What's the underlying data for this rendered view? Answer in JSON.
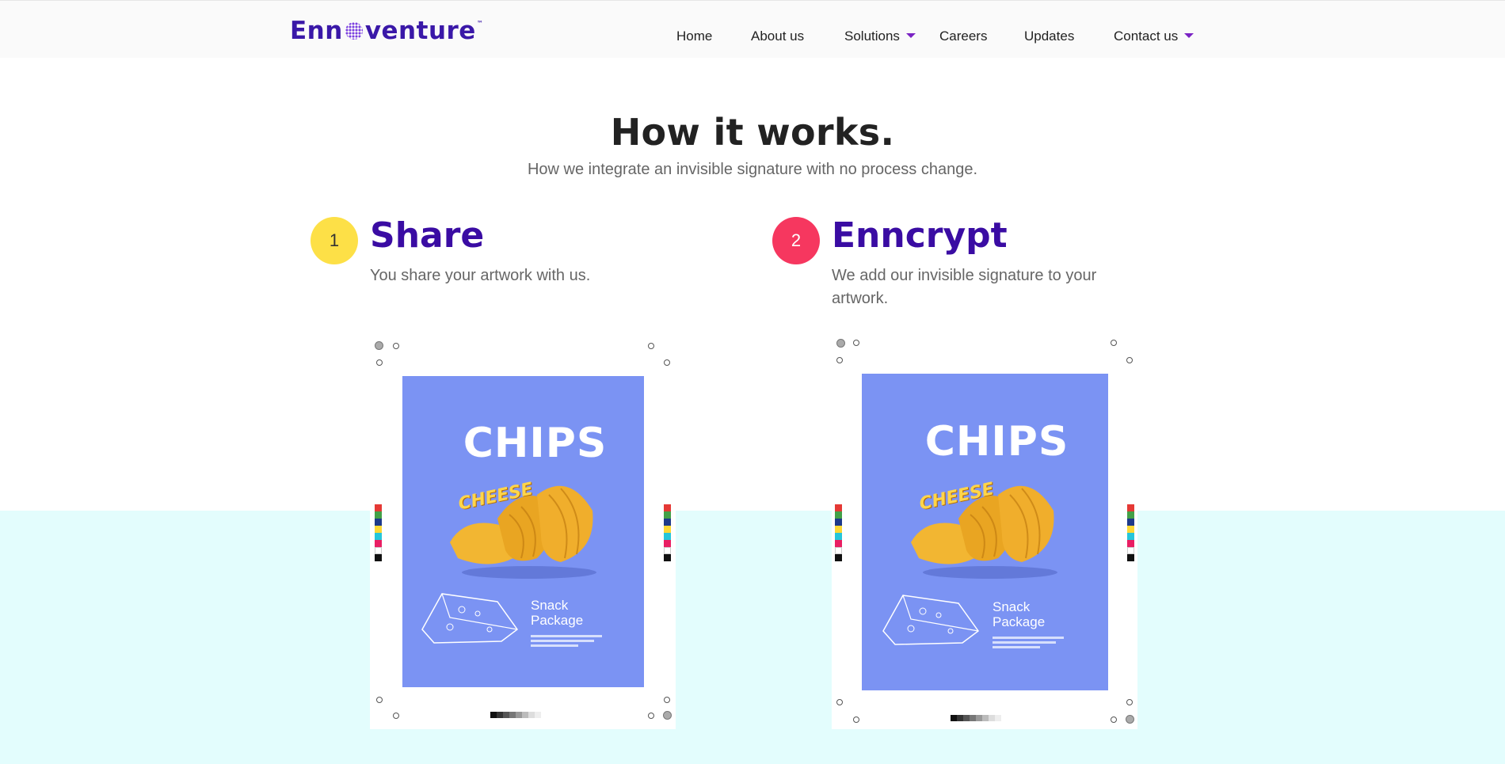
{
  "header": {
    "logo_text_left": "Enn",
    "logo_text_right": "venture",
    "logo_tm": "™",
    "nav": [
      {
        "label": "Home",
        "has_dropdown": false
      },
      {
        "label": "About us",
        "has_dropdown": false
      },
      {
        "label": "Solutions",
        "has_dropdown": true
      },
      {
        "label": "Careers",
        "has_dropdown": false
      },
      {
        "label": "Updates",
        "has_dropdown": false
      },
      {
        "label": "Contact us",
        "has_dropdown": true
      }
    ]
  },
  "section": {
    "title": "How it works.",
    "subtitle": "How we integrate an invisible signature with no process change."
  },
  "steps": [
    {
      "number": "1",
      "title": "Share",
      "description": "You share your artwork with us.",
      "badge_color": "#fde047",
      "artwork": {
        "headline": "CHIPS",
        "flavor": "CHEESE",
        "product_line1": "Snack",
        "product_line2": "Package"
      }
    },
    {
      "number": "2",
      "title": "Enncrypt",
      "description": "We add our invisible signature to your artwork.",
      "badge_color": "#f6375f",
      "artwork": {
        "headline": "CHIPS",
        "flavor": "CHEESE",
        "product_line1": "Snack",
        "product_line2": "Package"
      }
    }
  ],
  "colors": {
    "brand": "#3a18a8",
    "step_title": "#3a0ca3",
    "accent_caret": "#7a22c4",
    "package_bg": "#7b93f3",
    "band_bg": "#e3fdfd"
  }
}
